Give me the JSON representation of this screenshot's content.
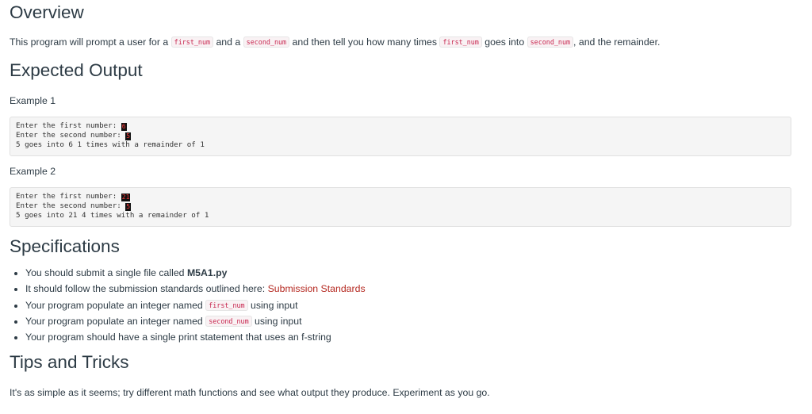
{
  "overview": {
    "heading": "Overview",
    "text_1": "This program will prompt a user for a",
    "code_first_num": "first_num",
    "text_2": "and a",
    "code_second_num": "second_num",
    "text_3": "and then tell you how many times",
    "text_4": "goes into",
    "text_5": ", and the remainder."
  },
  "expected_output": {
    "heading": "Expected Output",
    "examples": [
      {
        "label": "Example 1",
        "line1_prompt": "Enter the first number: ",
        "line1_input": "6",
        "line2_prompt": "Enter the second number: ",
        "line2_input": "5",
        "line3": "5 goes into 6 1 times with a remainder of 1"
      },
      {
        "label": "Example 2",
        "line1_prompt": "Enter the first number: ",
        "line1_input": "21",
        "line2_prompt": "Enter the second number: ",
        "line2_input": "5",
        "line3": "5 goes into 21 4 times with a remainder of 1"
      }
    ]
  },
  "specifications": {
    "heading": "Specifications",
    "item1_text": "You should submit a single file called ",
    "item1_filename": "M5A1.py",
    "item2_text": "It should follow the submission standards outlined here: ",
    "item2_link": "Submission Standards",
    "item3_text": "Your program populate an integer named ",
    "item3_code": "first_num",
    "item3_suffix": " using input",
    "item4_text": "Your program populate an integer named ",
    "item4_code": "second_num",
    "item4_suffix": " using input",
    "item5_text": "Your program should have a single print statement that uses an f-string"
  },
  "tips": {
    "heading": "Tips and Tricks",
    "text": "It's as simple as it seems; try different math functions and see what output they produce.  Experiment as you go."
  }
}
